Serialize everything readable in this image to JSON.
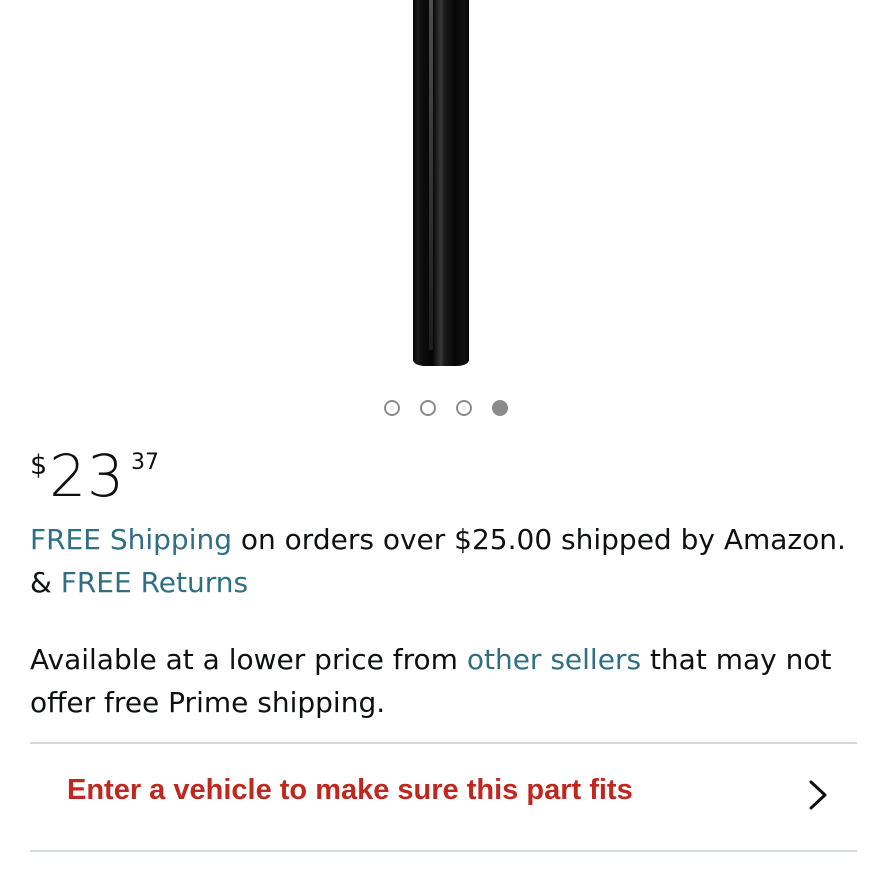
{
  "product": {
    "image_alt": "black pole product photo"
  },
  "carousel": {
    "total_dots": 4,
    "active_index": 3
  },
  "price": {
    "currency": "$",
    "whole": "23",
    "fraction": "37"
  },
  "shipping": {
    "free_shipping_link": "FREE Shipping",
    "text_middle": " on orders over $25.00 shipped by Amazon. & ",
    "free_returns_link": "FREE Returns"
  },
  "availability": {
    "text_before": "Available at a lower price from ",
    "other_sellers_link": "other sellers",
    "text_after": " that may not offer free Prime shipping."
  },
  "vehicle_fit": {
    "label": "Enter a vehicle to make sure this part fits",
    "icon": "chevron-right-icon"
  },
  "colors": {
    "link": "#2f6f83",
    "alert": "#c0281f",
    "text": "#0f1111",
    "divider": "#d5d9d9"
  }
}
